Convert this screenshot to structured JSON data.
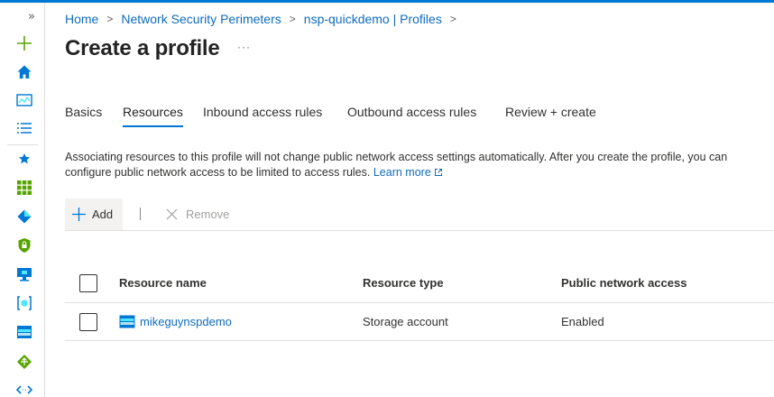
{
  "breadcrumb": {
    "home": "Home",
    "perimeters": "Network Security Perimeters",
    "profiles": "nsp-quickdemo | Profiles",
    "separator": ">"
  },
  "page": {
    "title": "Create a profile",
    "more": "···"
  },
  "rail": {
    "collapse": "»",
    "icons": [
      "plus-icon",
      "home-icon",
      "dashboard-icon",
      "all-services-icon",
      "favorites-star-icon",
      "all-resources-icon",
      "azure-devops-icon",
      "security-center-icon",
      "virtual-machine-icon",
      "resource-group-icon",
      "storage-icon",
      "network-icon",
      "code-icon"
    ],
    "accent": "#0078d4"
  },
  "tabs": [
    {
      "label": "Basics",
      "active": false
    },
    {
      "label": "Resources",
      "active": true
    },
    {
      "label": "Inbound access rules",
      "active": false
    },
    {
      "label": "Outbound access rules",
      "active": false
    },
    {
      "label": "Review + create",
      "active": false
    }
  ],
  "description": {
    "text": "Associating resources to this profile will not change public network access settings automatically. After you create the profile, you can configure public network access to be limited to access rules.",
    "learn_more": "Learn more"
  },
  "toolbar": {
    "add_label": "Add",
    "remove_label": "Remove"
  },
  "table": {
    "headers": {
      "name": "Resource name",
      "type": "Resource type",
      "access": "Public network access"
    },
    "rows": [
      {
        "name": "mikeguynspdemo",
        "type": "Storage account",
        "access": "Enabled"
      }
    ]
  },
  "colors": {
    "link": "#0f6cbd",
    "accent": "#0078d4",
    "text": "#323130"
  }
}
